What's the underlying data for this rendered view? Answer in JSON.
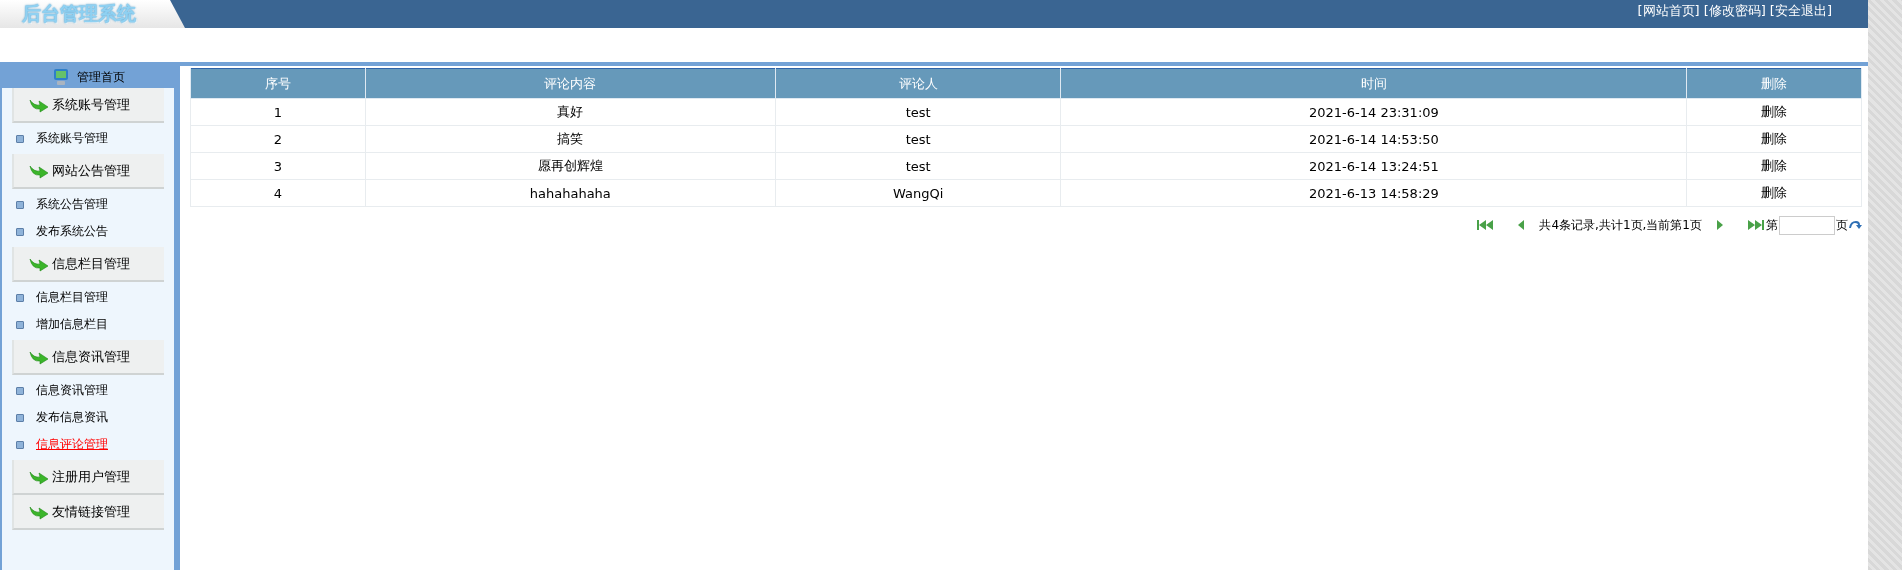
{
  "header": {
    "logo": "后台管理系统",
    "links": [
      "[网站首页]",
      "[修改密码]",
      "[安全退出]"
    ]
  },
  "sidebar": {
    "home": "管理首页",
    "groups": [
      {
        "title": "系统账号管理",
        "items": [
          {
            "label": "系统账号管理",
            "selected": false
          }
        ]
      },
      {
        "title": "网站公告管理",
        "items": [
          {
            "label": "系统公告管理",
            "selected": false
          },
          {
            "label": "发布系统公告",
            "selected": false
          }
        ]
      },
      {
        "title": "信息栏目管理",
        "items": [
          {
            "label": "信息栏目管理",
            "selected": false
          },
          {
            "label": "增加信息栏目",
            "selected": false
          }
        ]
      },
      {
        "title": "信息资讯管理",
        "items": [
          {
            "label": "信息资讯管理",
            "selected": false
          },
          {
            "label": "发布信息资讯",
            "selected": false
          },
          {
            "label": "信息评论管理",
            "selected": true
          }
        ]
      },
      {
        "title": "注册用户管理"
      },
      {
        "title": "友情链接管理"
      }
    ]
  },
  "table": {
    "columns": [
      "序号",
      "评论内容",
      "评论人",
      "时间",
      "删除"
    ],
    "rows": [
      [
        "1",
        "真好",
        "test",
        "2021-6-14 23:31:09",
        "删除"
      ],
      [
        "2",
        "搞笑",
        "test",
        "2021-6-14 14:53:50",
        "删除"
      ],
      [
        "3",
        "愿再创辉煌",
        "test",
        "2021-6-14 13:24:51",
        "删除"
      ],
      [
        "4",
        "hahahahaha",
        "WangQi",
        "2021-6-13 14:58:29",
        "删除"
      ]
    ]
  },
  "pagination": {
    "summary": "共4条记录,共计1页,当前第1页",
    "page_prefix": "第",
    "page_suffix": "页"
  }
}
